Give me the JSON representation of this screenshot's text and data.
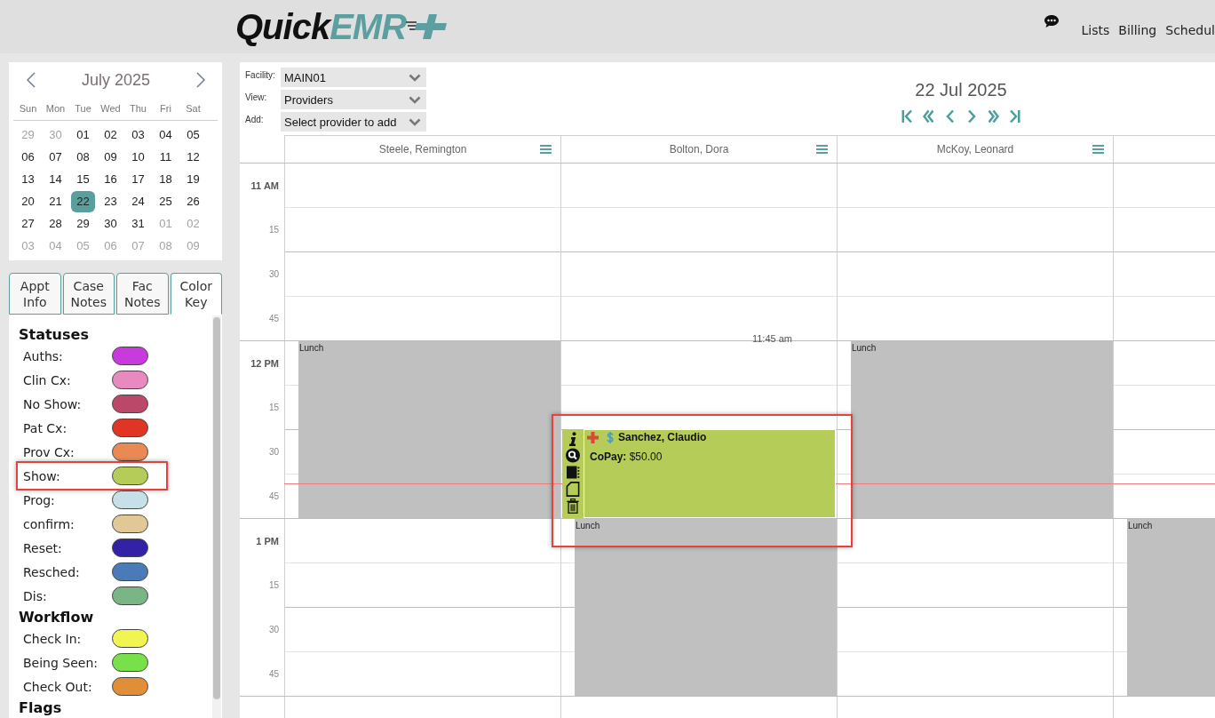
{
  "header": {
    "logo": {
      "part_1": "Quick",
      "part_2": "EMR"
    },
    "nav": [
      "Lists",
      "Billing",
      "Schedul"
    ]
  },
  "mini_calendar": {
    "month": "July 2025",
    "weekdays": [
      "Sun",
      "Mon",
      "Tue",
      "Wed",
      "Thu",
      "Fri",
      "Sat"
    ],
    "weeks": [
      [
        {
          "day": "29",
          "in_month": false,
          "selected": false
        },
        {
          "day": "30",
          "in_month": false,
          "selected": false
        },
        {
          "day": "01",
          "in_month": true,
          "selected": false
        },
        {
          "day": "02",
          "in_month": true,
          "selected": false
        },
        {
          "day": "03",
          "in_month": true,
          "selected": false
        },
        {
          "day": "04",
          "in_month": true,
          "selected": false
        },
        {
          "day": "05",
          "in_month": true,
          "selected": false
        }
      ],
      [
        {
          "day": "06",
          "in_month": true,
          "selected": false
        },
        {
          "day": "07",
          "in_month": true,
          "selected": false
        },
        {
          "day": "08",
          "in_month": true,
          "selected": false
        },
        {
          "day": "09",
          "in_month": true,
          "selected": false
        },
        {
          "day": "10",
          "in_month": true,
          "selected": false
        },
        {
          "day": "11",
          "in_month": true,
          "selected": false
        },
        {
          "day": "12",
          "in_month": true,
          "selected": false
        }
      ],
      [
        {
          "day": "13",
          "in_month": true,
          "selected": false
        },
        {
          "day": "14",
          "in_month": true,
          "selected": false
        },
        {
          "day": "15",
          "in_month": true,
          "selected": false
        },
        {
          "day": "16",
          "in_month": true,
          "selected": false
        },
        {
          "day": "17",
          "in_month": true,
          "selected": false
        },
        {
          "day": "18",
          "in_month": true,
          "selected": false
        },
        {
          "day": "19",
          "in_month": true,
          "selected": false
        }
      ],
      [
        {
          "day": "20",
          "in_month": true,
          "selected": false
        },
        {
          "day": "21",
          "in_month": true,
          "selected": false
        },
        {
          "day": "22",
          "in_month": true,
          "selected": true
        },
        {
          "day": "23",
          "in_month": true,
          "selected": false
        },
        {
          "day": "24",
          "in_month": true,
          "selected": false
        },
        {
          "day": "25",
          "in_month": true,
          "selected": false
        },
        {
          "day": "26",
          "in_month": true,
          "selected": false
        }
      ],
      [
        {
          "day": "27",
          "in_month": true,
          "selected": false
        },
        {
          "day": "28",
          "in_month": true,
          "selected": false
        },
        {
          "day": "29",
          "in_month": true,
          "selected": false
        },
        {
          "day": "30",
          "in_month": true,
          "selected": false
        },
        {
          "day": "31",
          "in_month": true,
          "selected": false
        },
        {
          "day": "01",
          "in_month": false,
          "selected": false
        },
        {
          "day": "02",
          "in_month": false,
          "selected": false
        }
      ],
      [
        {
          "day": "03",
          "in_month": false,
          "selected": false
        },
        {
          "day": "04",
          "in_month": false,
          "selected": false
        },
        {
          "day": "05",
          "in_month": false,
          "selected": false
        },
        {
          "day": "06",
          "in_month": false,
          "selected": false
        },
        {
          "day": "07",
          "in_month": false,
          "selected": false
        },
        {
          "day": "08",
          "in_month": false,
          "selected": false
        },
        {
          "day": "09",
          "in_month": false,
          "selected": false
        }
      ]
    ]
  },
  "side_tabs": [
    {
      "label": "Appt Info",
      "selected": false
    },
    {
      "label": "Case Notes",
      "selected": false
    },
    {
      "label": "Fac Notes",
      "selected": false
    },
    {
      "label": "Color Key",
      "selected": true
    }
  ],
  "color_key": {
    "groups": [
      {
        "title": "Statuses",
        "items": [
          {
            "label": "Auths:",
            "color": "#c83adb",
            "highlighted": false
          },
          {
            "label": "Clin Cx:",
            "color": "#e889bf",
            "highlighted": false
          },
          {
            "label": "No Show:",
            "color": "#bc4869",
            "highlighted": false
          },
          {
            "label": "Pat Cx:",
            "color": "#e03424",
            "highlighted": false
          },
          {
            "label": "Prov Cx:",
            "color": "#e98a56",
            "highlighted": false
          },
          {
            "label": "Show:",
            "color": "#b6cc58",
            "highlighted": true
          },
          {
            "label": "Prog:",
            "color": "#c6dfe8",
            "highlighted": false
          },
          {
            "label": "confirm:",
            "color": "#e2c797",
            "highlighted": false
          },
          {
            "label": "Reset:",
            "color": "#3321a8",
            "highlighted": false
          },
          {
            "label": "Resched:",
            "color": "#4a7bb6",
            "highlighted": false
          },
          {
            "label": "Dis:",
            "color": "#7ab585",
            "highlighted": false
          }
        ]
      },
      {
        "title": "Workflow",
        "items": [
          {
            "label": "Check In:",
            "color": "#f0f552",
            "highlighted": false
          },
          {
            "label": "Being Seen:",
            "color": "#78e14a",
            "highlighted": false
          },
          {
            "label": "Check Out:",
            "color": "#e08f38",
            "highlighted": false
          }
        ]
      },
      {
        "title": "Flags"
      }
    ]
  },
  "toolbar": {
    "fields": [
      {
        "label": "Facility:",
        "value": "MAIN01"
      },
      {
        "label": "View:",
        "value": "Providers"
      },
      {
        "label": "Add:",
        "value": "Select provider to add"
      }
    ]
  },
  "date_nav": {
    "title": "22 Jul 2025"
  },
  "schedule": {
    "columns": [
      {
        "name": "Steele, Remington"
      },
      {
        "name": "Bolton, Dora"
      },
      {
        "name": "McKoy, Leonard"
      }
    ],
    "hours": [
      {
        "label": "11 AM",
        "quarters": [
          "15",
          "30",
          "45"
        ],
        "cells": [
          {
            "kind": "open"
          },
          {
            "kind": "open",
            "note": "11:45 am"
          },
          {
            "kind": "open"
          },
          {
            "kind": "open"
          }
        ]
      },
      {
        "label": "12 PM",
        "quarters": [
          "15",
          "30",
          "45"
        ],
        "cells": [
          {
            "kind": "lunch",
            "label": "Lunch"
          },
          {
            "kind": "open",
            "appointment": {
              "name": "Sanchez, Claudio",
              "detail": "**CoPay:** $50.00",
              "color": "#b6cc58",
              "highlighted": true
            }
          },
          {
            "kind": "lunch",
            "label": "Lunch"
          },
          {
            "kind": "open"
          }
        ]
      },
      {
        "label": "1 PM",
        "quarters": [
          "15",
          "30",
          "45"
        ],
        "cells": [
          {
            "kind": "open"
          },
          {
            "kind": "lunch",
            "label": "Lunch"
          },
          {
            "kind": "open"
          },
          {
            "kind": "lunch",
            "label": "Lunch"
          }
        ]
      }
    ]
  }
}
